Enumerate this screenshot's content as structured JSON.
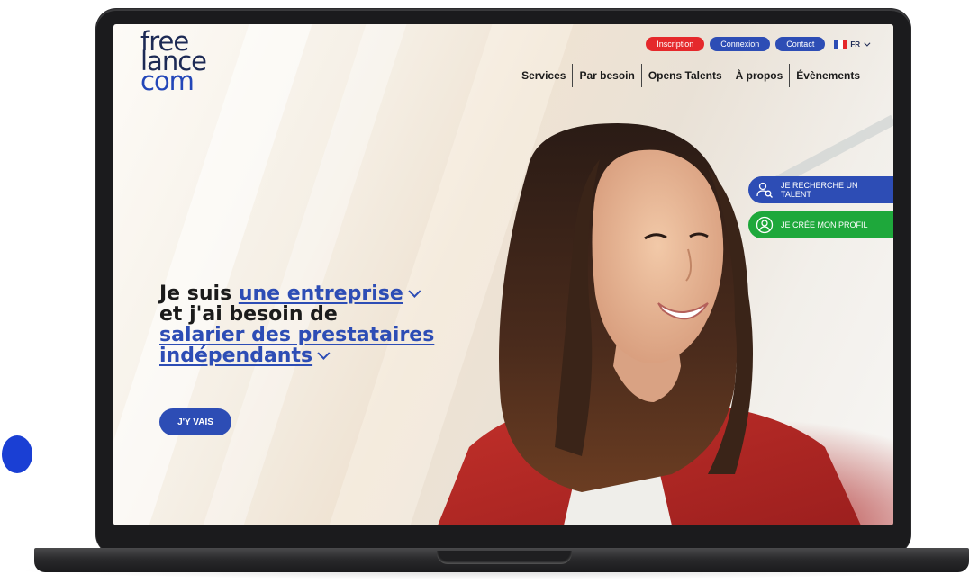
{
  "logo": {
    "line1": "free",
    "line2": "lance",
    "line3": "com"
  },
  "top_bar": {
    "inscription_label": "Inscription",
    "connexion_label": "Connexion",
    "contact_label": "Contact",
    "language": "FR"
  },
  "nav": {
    "items": [
      "Services",
      "Par besoin",
      "Opens Talents",
      "À propos",
      "Évènements"
    ]
  },
  "side_cta": {
    "find_talent": "JE RECHERCHE UN TALENT",
    "create_profile": "JE CRÉE MON PROFIL"
  },
  "hero": {
    "prefix": "Je suis ",
    "role": "une entreprise",
    "line2": "et j'ai besoin de",
    "need_line1": "salarier des prestataires",
    "need_line2": "indépendants",
    "button": "J'Y VAIS"
  },
  "colors": {
    "brand_blue": "#2d4db5",
    "brand_red": "#e5282b",
    "brand_green": "#1ea83b",
    "logo_navy": "#1d2a55"
  }
}
